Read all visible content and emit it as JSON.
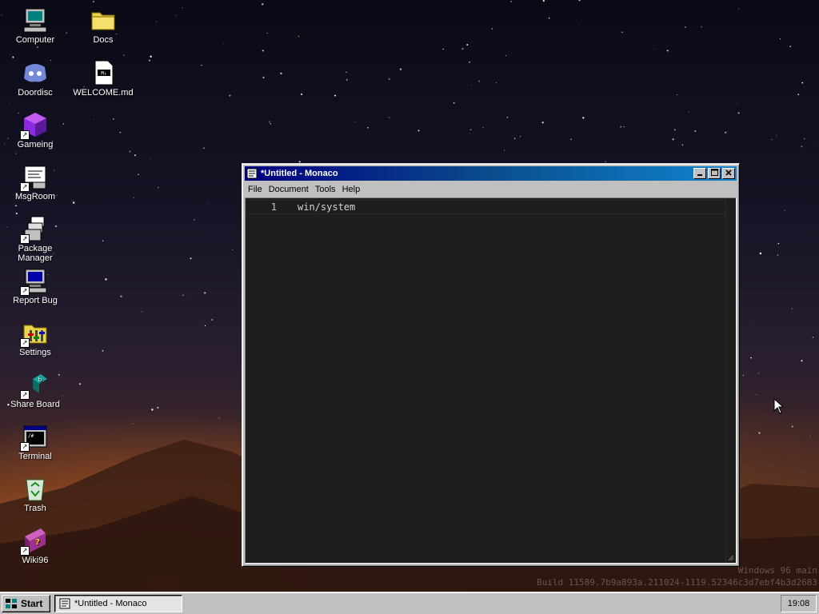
{
  "desktop": {
    "icons": [
      {
        "label": "Computer",
        "icon": "computer-icon"
      },
      {
        "label": "Docs",
        "icon": "folder-icon"
      },
      {
        "label": "Doordisc",
        "icon": "discord-icon"
      },
      {
        "label": "WELCOME.md",
        "icon": "markdown-file-icon"
      },
      {
        "label": "Gameing",
        "icon": "game-cube-icon"
      },
      {
        "label": "MsgRoom",
        "icon": "chat-room-icon"
      },
      {
        "label": "Package Manager",
        "icon": "package-icon"
      },
      {
        "label": "Report Bug",
        "icon": "bug-report-icon"
      },
      {
        "label": "Settings",
        "icon": "settings-icon"
      },
      {
        "label": "Share Board",
        "icon": "share-board-icon"
      },
      {
        "label": "Terminal",
        "icon": "terminal-icon"
      },
      {
        "label": "Trash",
        "icon": "recycle-bin-icon"
      },
      {
        "label": "Wiki96",
        "icon": "help-book-icon"
      }
    ],
    "watermark": {
      "line1": "Windows 96 main",
      "line2": "Build 11589.7b9a893a.211024-1119.52346c3d7ebf4b3d2683"
    }
  },
  "window": {
    "title": "*Untitled - Monaco",
    "menu": [
      "File",
      "Document",
      "Tools",
      "Help"
    ],
    "editor": {
      "line_number": "1",
      "line_text": "win/system"
    }
  },
  "taskbar": {
    "start_label": "Start",
    "task_label": "*Untitled - Monaco",
    "clock": "19:08"
  },
  "colors": {
    "titlebar_start": "#000080",
    "titlebar_end": "#1084d0",
    "editor_bg": "#1e1e1e",
    "chrome": "#c0c0c0"
  }
}
